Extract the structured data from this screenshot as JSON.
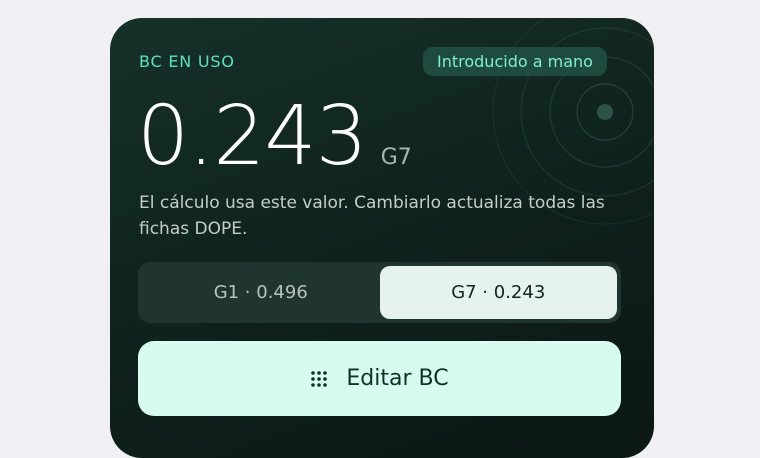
{
  "card": {
    "eyebrow": "BC EN USO",
    "source_badge": "Introducido a mano",
    "value": "0.243",
    "unit": "G7",
    "description": "El cálculo usa este valor. Cambiarlo actualiza todas las fichas DOPE."
  },
  "segments": [
    {
      "label": "G1 · 0.496",
      "selected": false
    },
    {
      "label": "G7 · 0.243",
      "selected": true
    }
  ],
  "edit_button": {
    "icon": "keypad-grid-icon",
    "label": "Editar BC"
  },
  "decor": {
    "icon": "concentric-rings-icon"
  },
  "colors": {
    "card_bg": "#12261f",
    "accent": "#5fe0c0",
    "badge_bg": "#1f4a3f",
    "button_bg": "#d8fbf0"
  }
}
